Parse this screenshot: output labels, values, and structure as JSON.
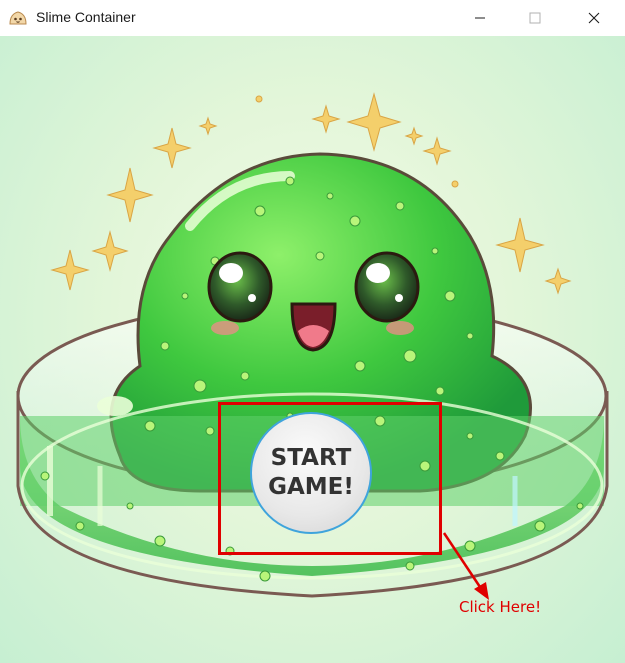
{
  "window": {
    "title": "Slime Container",
    "app_icon": "slime-app-icon"
  },
  "window_controls": {
    "minimize_icon": "minimize-icon",
    "maximize_icon": "maximize-icon",
    "close_icon": "close-icon"
  },
  "scene": {
    "description_icon": "slime-in-petri-dish-illustration",
    "colors": {
      "slime": "#3fc83f",
      "slime_dark": "#2ea52e",
      "dish_liquid": "#63d36a",
      "sparkle": "#f4cf6b",
      "background": "#e3f6d9"
    }
  },
  "start_button": {
    "label": "START\nGAME!",
    "border_color": "#3fa4dc"
  },
  "hint": {
    "text": "Click Here!",
    "color": "#e00000"
  }
}
